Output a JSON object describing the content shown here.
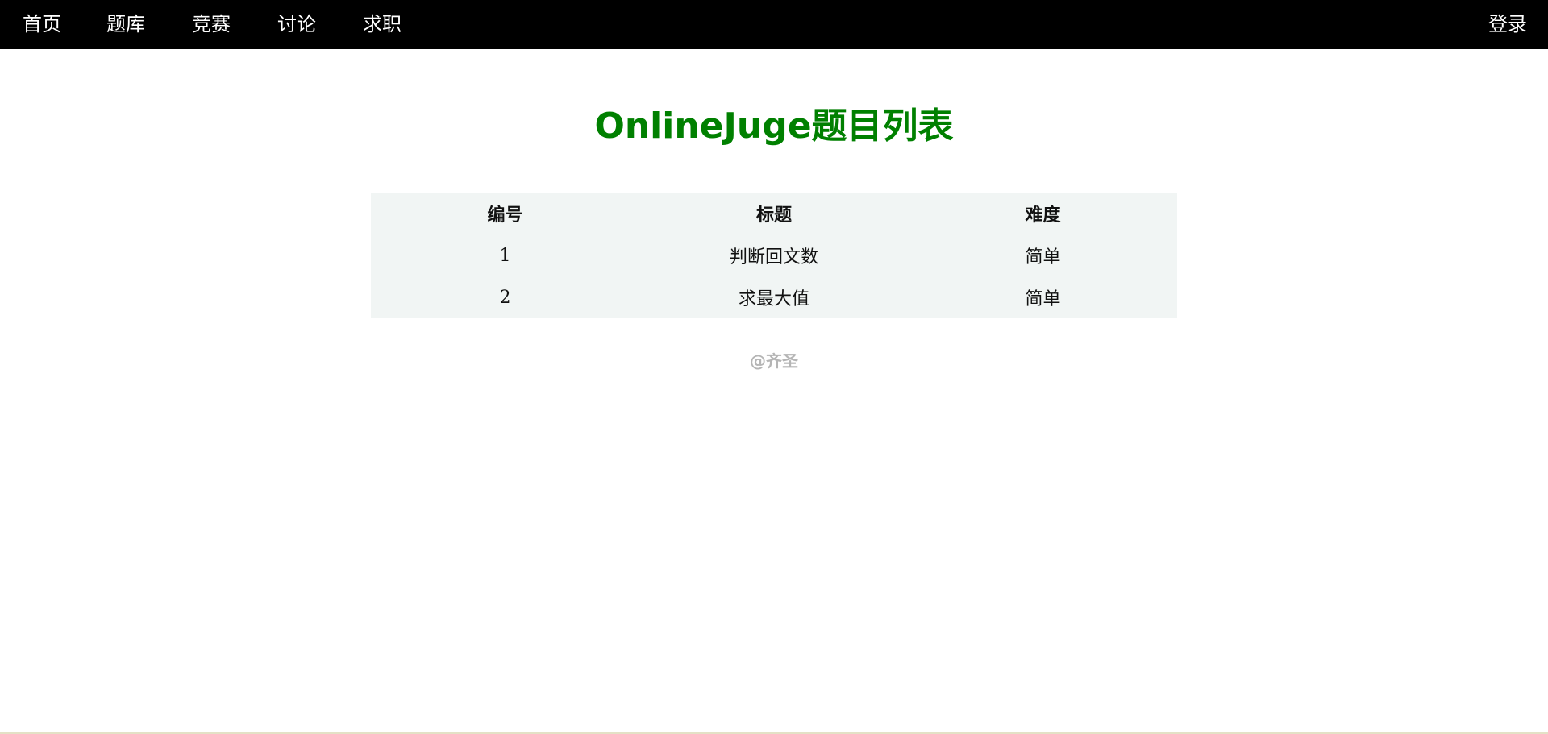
{
  "navbar": {
    "items": [
      {
        "label": "首页"
      },
      {
        "label": "题库"
      },
      {
        "label": "竞赛"
      },
      {
        "label": "讨论"
      },
      {
        "label": "求职"
      }
    ],
    "login_label": "登录"
  },
  "page": {
    "title": "OnlineJuge题目列表"
  },
  "table": {
    "headers": [
      "编号",
      "标题",
      "难度"
    ],
    "rows": [
      {
        "id": "1",
        "title": "判断回文数",
        "level": "简单"
      },
      {
        "id": "2",
        "title": "求最大值",
        "level": "简单"
      }
    ]
  },
  "footer": {
    "text": "@齐圣"
  },
  "colors": {
    "navbar_bg": "#000000",
    "title": "#008000",
    "table_bg": "#f1f5f4",
    "footer_text": "#b5b5b5"
  }
}
